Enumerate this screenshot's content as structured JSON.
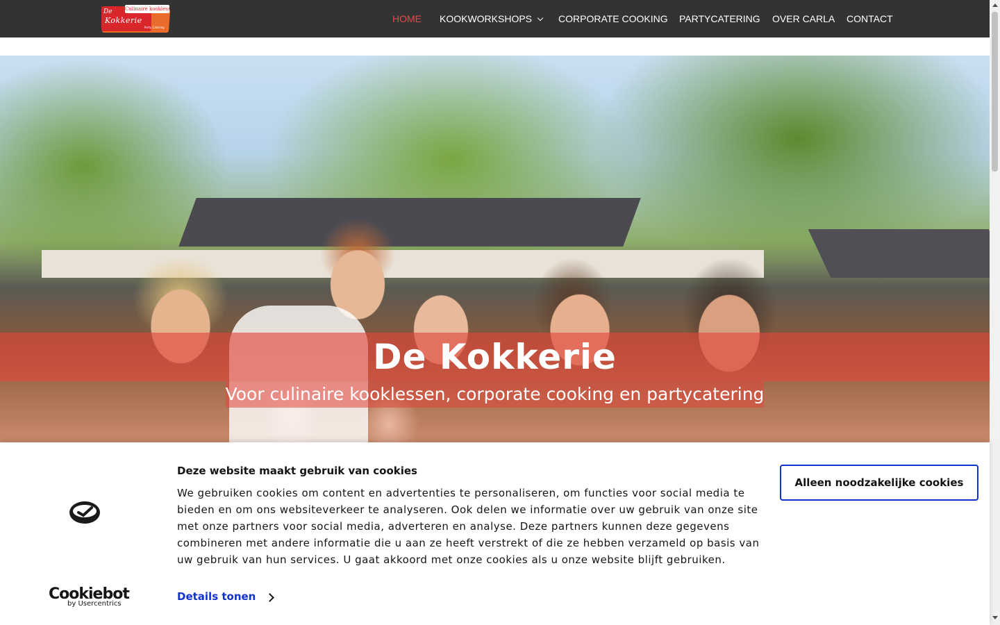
{
  "nav": {
    "logo": {
      "tagline": "Culinaire kooklessen",
      "de": "De",
      "name": "Kokkerie",
      "sub": "Party Catering"
    },
    "items": [
      {
        "label": "HOME",
        "active": true
      },
      {
        "label": "KOOKWORKSHOPS",
        "has_dropdown": true
      },
      {
        "label": "CORPORATE COOKING"
      },
      {
        "label": "PARTYCATERING"
      },
      {
        "label": "OVER CARLA"
      },
      {
        "label": "CONTACT"
      }
    ],
    "active_color": "#e8484c",
    "background": "#333333"
  },
  "hero": {
    "title": "De Kokkerie",
    "subtitle": "Voor culinaire kooklessen, corporate cooking en partycatering",
    "band_color": "#e0463c"
  },
  "cookie_banner": {
    "heading": "Deze website maakt gebruik van cookies",
    "body": "We gebruiken cookies om content en advertenties te personaliseren, om functies voor social media te bieden en om ons websiteverkeer te analyseren. Ook delen we informatie over uw gebruik van onze site met onze partners voor social media, adverteren en analyse. Deze partners kunnen deze gegevens combineren met andere informatie die u aan ze heeft verstrekt of die ze hebben verzameld op basis van uw gebruik van hun services. U gaat akkoord met onze cookies als u onze website blijft gebruiken.",
    "details_label": "Details tonen",
    "necessary_button": "Alleen noodzakelijke cookies",
    "brand": "Cookiebot",
    "brand_byline": "by Usercentrics",
    "link_color": "#1032cf"
  }
}
